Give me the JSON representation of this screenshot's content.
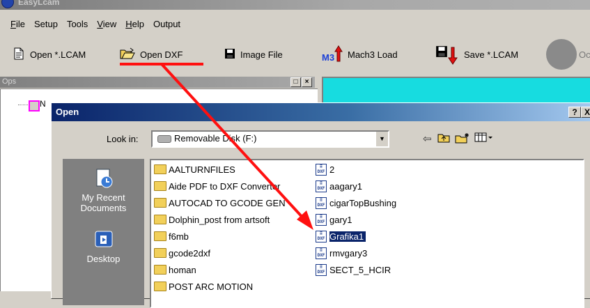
{
  "window": {
    "title": "EasyLcam"
  },
  "menu": {
    "items": [
      "File",
      "Setup",
      "Tools",
      "View",
      "Help",
      "Output"
    ]
  },
  "toolbar": {
    "open_lcam": "Open *.LCAM",
    "open_dxf": "Open DXF",
    "image_file": "Image File",
    "mach3_load": "Mach3 Load",
    "mach3_tag": "M3",
    "save_lcam": "Save *.LCAM",
    "partial": "Oc"
  },
  "ops": {
    "title": "Ops",
    "tree_label": "N"
  },
  "dialog": {
    "title": "Open",
    "help": "?",
    "close": "X",
    "look_in_label": "Look in:",
    "look_in_value": "Removable Disk (F:)",
    "places": [
      "My Recent Documents",
      "Desktop"
    ],
    "folders": [
      "AALTURNFILES",
      "Aide PDF to DXF Converter",
      "AUTOCAD TO GCODE GEN",
      "Dolphin_post from artsoft",
      "f6mb",
      "gcode2dxf",
      "homan",
      "POST ARC MOTION"
    ],
    "files": [
      "2",
      "aagary1",
      "cigarTopBushing",
      "gary1",
      "Grafika1",
      "rmvgary3",
      "SECT_5_HCIR"
    ],
    "selected_file": "Grafika1"
  },
  "colors": {
    "annotation": "#ff1010",
    "selection": "#0a246a",
    "view_bg": "#17dce0"
  }
}
